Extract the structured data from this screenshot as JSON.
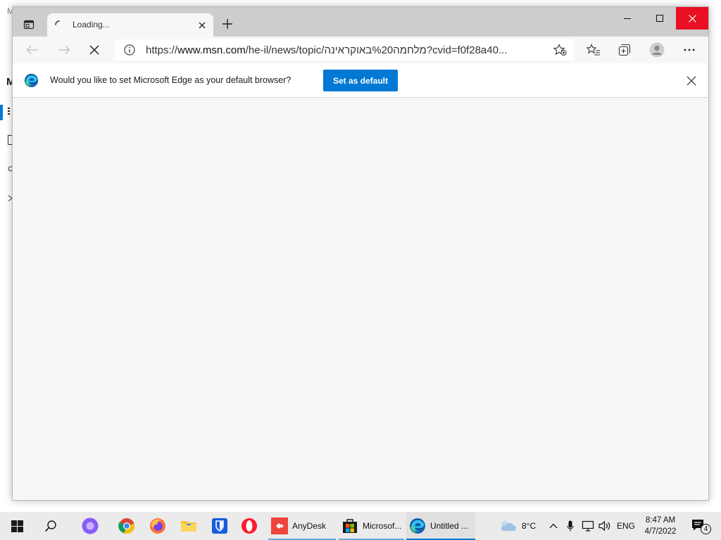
{
  "background_app": {
    "title_fragment": "M",
    "heading_fragment": "M"
  },
  "browser": {
    "tab": {
      "title": "Loading..."
    },
    "address_bar": {
      "url_scheme": "https://",
      "url_host": "www.msn.com",
      "url_path": "/he-il/news/topic/מלחמה%20באוקראינה?cvid=f0f28a40..."
    },
    "infobar": {
      "message": "Would you like to set Microsoft Edge as your default browser?",
      "button_label": "Set as default"
    }
  },
  "taskbar": {
    "apps": [
      {
        "label": "AnyDesk",
        "icon": "anydesk-icon"
      },
      {
        "label": "Microsof...",
        "icon": "microsoft-store-icon"
      },
      {
        "label": "Untitled ...",
        "icon": "edge-icon"
      }
    ],
    "weather": {
      "temperature": "8°C",
      "icon": "partly-cloudy-icon"
    },
    "language": "ENG",
    "clock": {
      "time": "8:47 AM",
      "date": "4/7/2022"
    },
    "notifications_count": "4"
  },
  "colors": {
    "accent": "#0078d4",
    "close_red": "#e81123",
    "titlebar": "#cdcdcd",
    "content_bg": "#f7f7f7"
  }
}
